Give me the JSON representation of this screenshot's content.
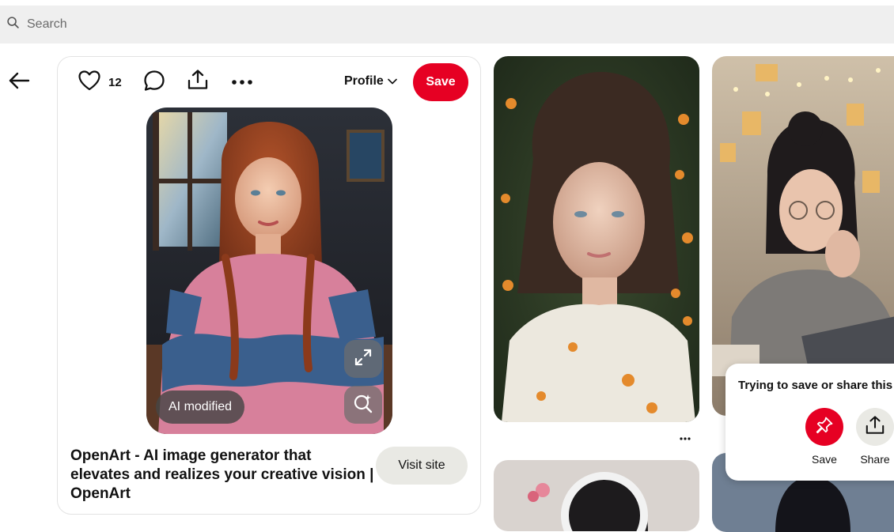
{
  "search": {
    "placeholder": "Search",
    "value": ""
  },
  "pin": {
    "like_count": "12",
    "profile_label": "Profile",
    "save_label": "Save",
    "ai_badge": "AI modified",
    "title": "OpenArt - AI image generator that elevates and realizes your creative vision | OpenArt",
    "visit_label": "Visit site"
  },
  "popover": {
    "title": "Trying to save or share this",
    "save_label": "Save",
    "share_label": "Share"
  },
  "colors": {
    "brand_red": "#e60023",
    "search_bg": "#efefef",
    "visit_bg": "#e9e9e4"
  },
  "icons": [
    "search-icon",
    "back-arrow-icon",
    "heart-icon",
    "comment-icon",
    "share-icon",
    "more-icon",
    "chevron-down-icon",
    "expand-icon",
    "visual-search-icon",
    "pin-icon",
    "upload-icon"
  ]
}
